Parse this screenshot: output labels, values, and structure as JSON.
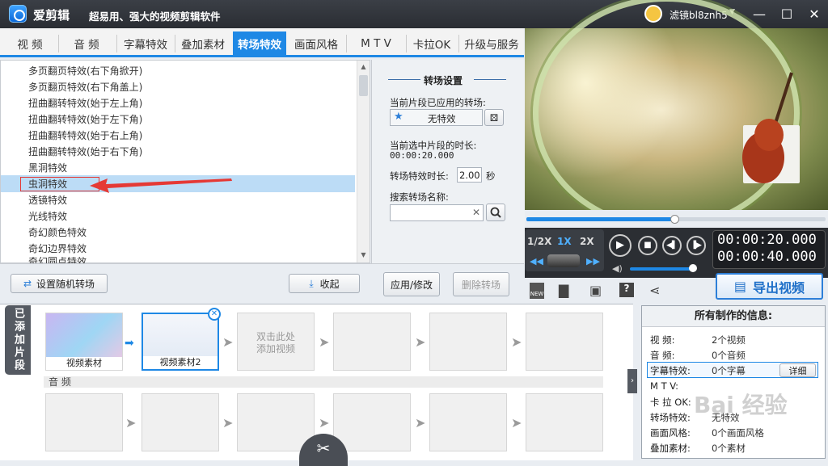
{
  "app": {
    "name": "爱剪辑",
    "slogan": "超易用、强大的视频剪辑软件",
    "username": "滤镜bl8znh5"
  },
  "tabs": [
    "视 频",
    "音 频",
    "字幕特效",
    "叠加素材",
    "转场特效",
    "画面风格",
    "M T V",
    "卡拉OK",
    "升级与服务"
  ],
  "effects": [
    "多页翻页特效(右下角掀开)",
    "多页翻页特效(右下角盖上)",
    "扭曲翻转特效(始于左上角)",
    "扭曲翻转特效(始于左下角)",
    "扭曲翻转特效(始于右上角)",
    "扭曲翻转特效(始于右下角)",
    "黑洞特效",
    "虫洞特效",
    "透镜特效",
    "光线特效",
    "奇幻颜色特效",
    "奇幻边界特效",
    "奇幻圆点特效"
  ],
  "settings": {
    "title": "转场设置",
    "applied_label": "当前片段已应用的转场:",
    "applied_value": "无特效",
    "duration_label": "当前选中片段的时长:",
    "duration_value": "00:00:20.000",
    "effect_duration_label": "转场特效时长:",
    "effect_duration_value": "2.00",
    "effect_duration_unit": "秒",
    "search_label": "搜索转场名称:",
    "search_value": "",
    "apply_button": "应用/修改",
    "delete_button": "删除转场"
  },
  "bottom_buttons": {
    "random": "设置随机转场",
    "collapse": "收起"
  },
  "player": {
    "current_time": "00:00:20.000",
    "total_time": "00:00:40.000",
    "speeds": [
      "1/2X",
      "1X",
      "2X"
    ],
    "export": "导出视频"
  },
  "timeline": {
    "tab_label": "已添加片段",
    "clips": [
      "视频素材",
      "视频素材2"
    ],
    "add_hint_line1": "双击此处",
    "add_hint_line2": "添加视频",
    "audio_label": "音 频"
  },
  "info": {
    "title": "所有制作的信息:",
    "rows": [
      {
        "label": "视    频:",
        "value": "2个视频"
      },
      {
        "label": "音    频:",
        "value": "0个音频"
      },
      {
        "label": "字幕特效:",
        "value": "0个字幕"
      },
      {
        "label": "M  T  V:",
        "value": ""
      },
      {
        "label": "卡 拉 OK:",
        "value": ""
      },
      {
        "label": "转场特效:",
        "value": "无特效"
      },
      {
        "label": "画面风格:",
        "value": "0个画面风格"
      },
      {
        "label": "叠加素材:",
        "value": "0个素材"
      }
    ],
    "detail_button": "详细"
  },
  "watermark": "Bai 经验"
}
